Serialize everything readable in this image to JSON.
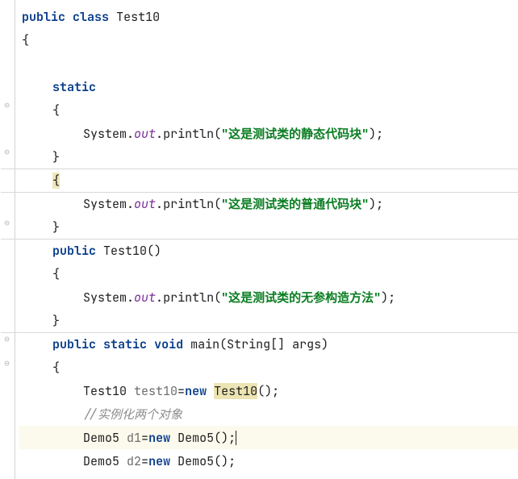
{
  "code": {
    "kw_public": "public",
    "kw_class": "class",
    "class_name": "Test10",
    "brace_open": "{",
    "brace_close": "}",
    "kw_static": "static",
    "sys": "System",
    "dot": ".",
    "out": "out",
    "println": "println",
    "paren_open": "(",
    "paren_close": ")",
    "semi": ";",
    "str_static_block": "\"这是测试类的静态代码块\"",
    "str_instance_block": "\"这是测试类的普通代码块\"",
    "ctor_name": "Test10",
    "str_ctor": "\"这是测试类的无参构造方法\"",
    "kw_void": "void",
    "main": "main",
    "main_params": "String[] args",
    "var_type_test": "Test10",
    "var_name_test": "test10",
    "eq": "=",
    "kw_new": "new",
    "new_test": "Test10",
    "empty_args": "()",
    "comment_inst": "//实例化两个对象",
    "var_type_demo": "Demo5",
    "var_name_d1": "d1",
    "var_name_d2": "d2",
    "new_demo": "Demo5"
  }
}
